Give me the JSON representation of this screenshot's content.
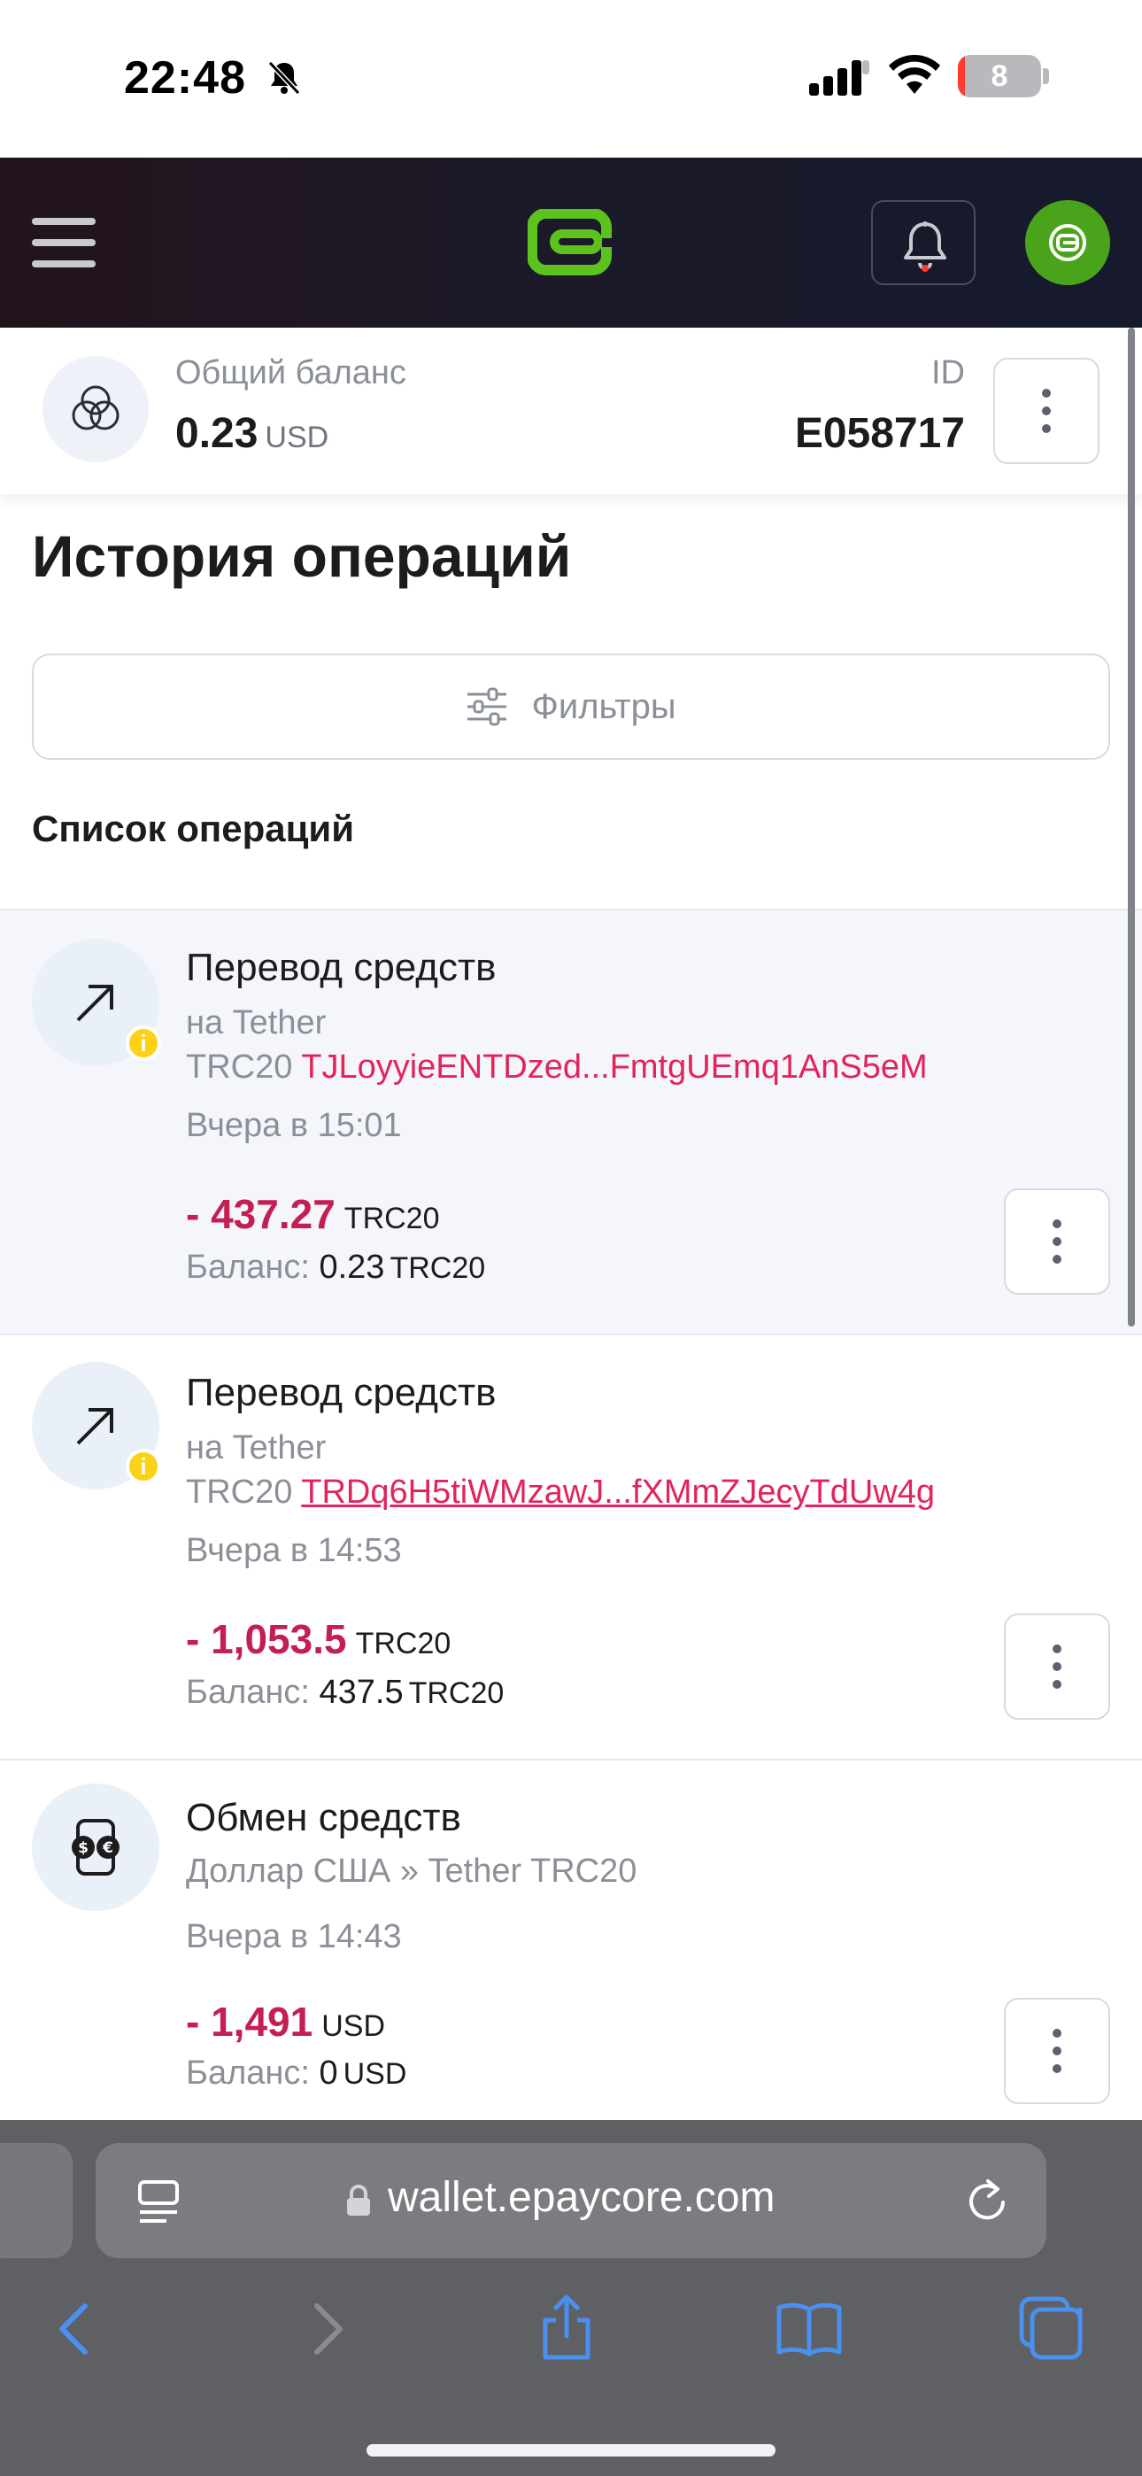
{
  "status_bar": {
    "time": "22:48",
    "battery": "8",
    "battery_level": 0.08
  },
  "header": {
    "menu_icon": "hamburger-icon",
    "logo_icon": "epaycore-logo-icon",
    "notifications_icon": "bell-icon",
    "avatar_icon": "epaycore-avatar-icon",
    "colors": {
      "brand_green": "#4aa41b",
      "header_dark": "#1b1a2a"
    }
  },
  "balance": {
    "label": "Общий баланс",
    "value": "0.23",
    "unit": "USD",
    "id_label": "ID",
    "id_value": "E058717"
  },
  "page": {
    "title": "История операций",
    "filters_label": "Фильтры",
    "list_title": "Список операций"
  },
  "operations": [
    {
      "title": "Перевод средств",
      "line1": "на Tether",
      "line2_prefix": "TRC20",
      "address": "TJLoyyieENTDzed...FmtgUEmq1AnS5eM",
      "time": "Вчера в 15:01",
      "amount": "- 437.27",
      "amount_currency": "TRC20",
      "balance_label": "Баланс:",
      "balance_value": "0.23",
      "balance_currency": "TRC20",
      "icon": "arrow-up-right-icon",
      "selected": true
    },
    {
      "title": "Перевод средств",
      "line1": "на Tether",
      "line2_prefix": "TRC20",
      "address": "TRDq6H5tiWMzawJ...fXMmZJecyTdUw4g",
      "time": "Вчера в 14:53",
      "amount": "- 1,053.5",
      "amount_currency": "TRC20",
      "balance_label": "Баланс:",
      "balance_value": "437.5",
      "balance_currency": "TRC20",
      "icon": "arrow-up-right-icon",
      "selected": false
    },
    {
      "title": "Обмен средств",
      "line1": "Доллар США » Tether TRC20",
      "time": "Вчера в 14:43",
      "amount": "- 1,491",
      "amount_currency": "USD",
      "balance_label": "Баланс:",
      "balance_value": "0",
      "balance_currency": "USD",
      "icon": "currency-exchange-icon",
      "selected": false
    }
  ],
  "browser": {
    "url": "wallet.epaycore.com"
  }
}
